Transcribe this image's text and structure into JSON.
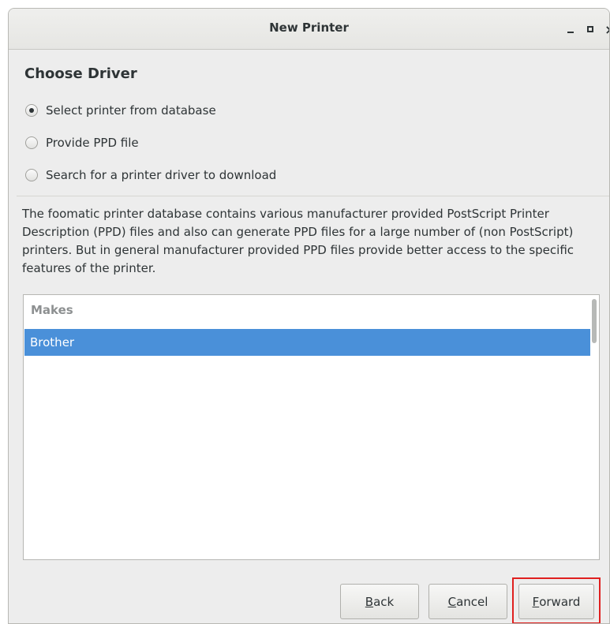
{
  "window": {
    "title": "New Printer",
    "controls": [
      "minimize-icon",
      "maximize-icon",
      "close-icon"
    ],
    "close_glyph": "×"
  },
  "page": {
    "heading": "Choose Driver"
  },
  "options": [
    {
      "label": "Select printer from database",
      "selected": true
    },
    {
      "label": "Provide PPD file",
      "selected": false
    },
    {
      "label": "Search for a printer driver to download",
      "selected": false
    }
  ],
  "description": "The foomatic printer database contains various manufacturer provided PostScript Printer Description (PPD) files and also can generate PPD files for a large number of (non PostScript) printers. But in general manufacturer provided PPD files provide better access to the specific features of the printer.",
  "makes_list": {
    "header": "Makes",
    "items": [
      "Brother"
    ],
    "selected_item": "Brother"
  },
  "buttons": {
    "back_mnemonic": "B",
    "back_rest": "ack",
    "cancel_mnemonic": "C",
    "cancel_rest": "ancel",
    "forward_mnemonic": "F",
    "forward_rest": "orward"
  },
  "colors": {
    "selection": "#4a90d9",
    "highlight_box": "#e0201f"
  }
}
